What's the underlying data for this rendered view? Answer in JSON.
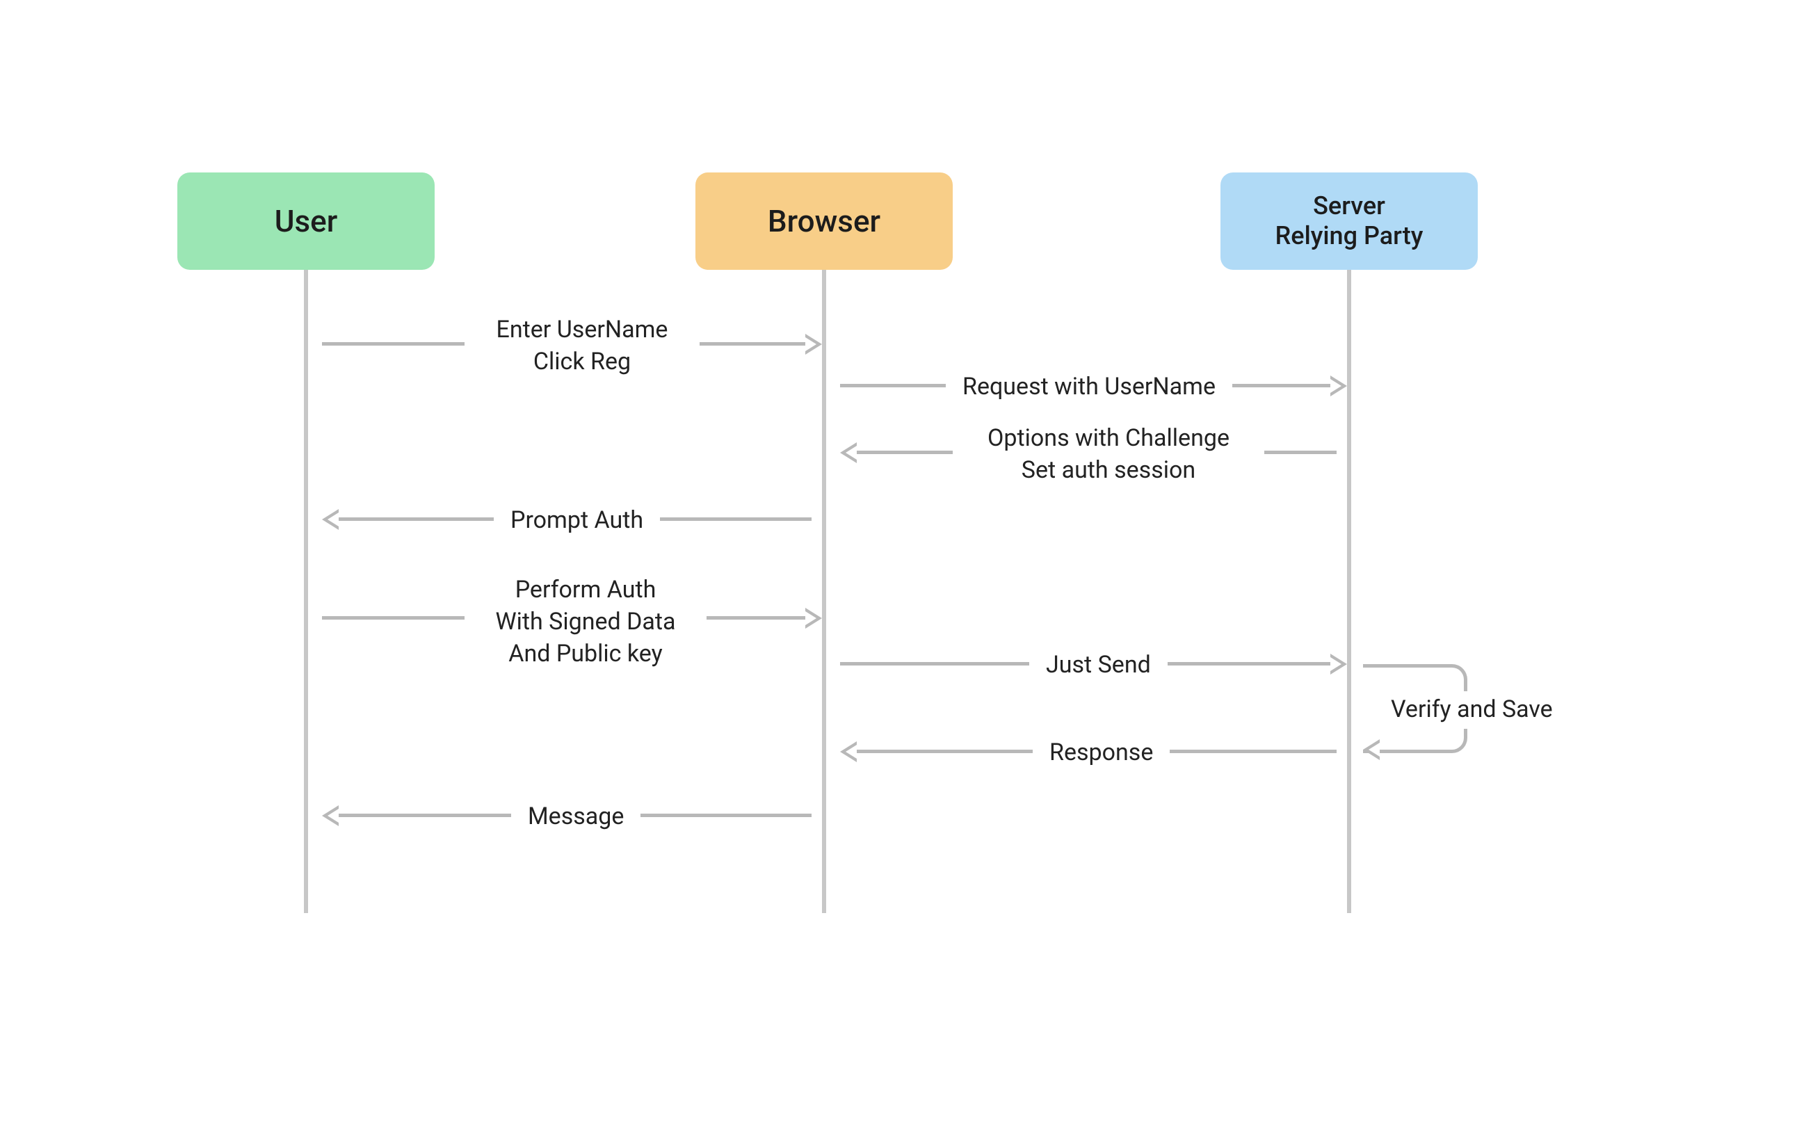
{
  "actors": {
    "user": {
      "label": "User"
    },
    "browser": {
      "label": "Browser"
    },
    "server": {
      "line1": "Server",
      "line2": "Relying Party"
    }
  },
  "messages": {
    "m1_l1": "Enter UserName",
    "m1_l2": "Click Reg",
    "m2": "Request with UserName",
    "m3_l1": "Options with Challenge",
    "m3_l2": "Set auth session",
    "m4": "Prompt Auth",
    "m5_l1": "Perform Auth",
    "m5_l2": "With Signed Data",
    "m5_l3": "And Public key",
    "m6": "Just Send",
    "m7": "Verify and Save",
    "m8": "Response",
    "m9": "Message"
  },
  "colors": {
    "user_bg": "#9be6b4",
    "browser_bg": "#f8ce88",
    "server_bg": "#b0daf6",
    "line": "#c7c7c7",
    "arrow": "#b8b8b8"
  }
}
